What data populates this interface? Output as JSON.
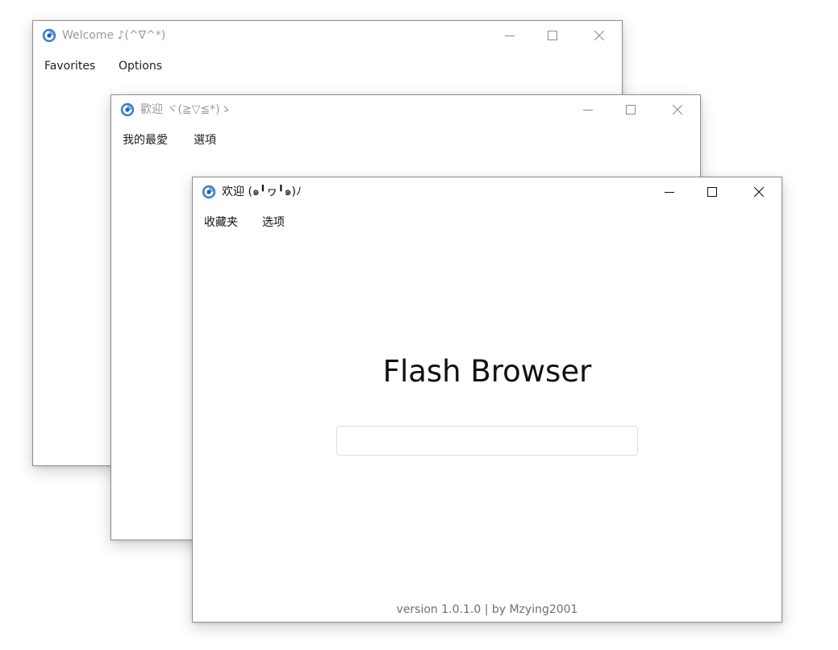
{
  "windows": {
    "back": {
      "title": "Welcome ♪(^∇^*)",
      "menu": [
        "Favorites",
        "Options"
      ]
    },
    "middle": {
      "title": "歡迎 ヾ(≧▽≦*)ゝ",
      "menu": [
        "我的最愛",
        "選項"
      ]
    },
    "front": {
      "title": "欢迎 (๑╹ヮ╹๑)ﾉ",
      "menu": [
        "收藏夹",
        "选项"
      ],
      "heading": "Flash Browser",
      "url_input": {
        "value": "",
        "placeholder": ""
      },
      "footer": "version 1.0.1.0 | by Mzying2001"
    }
  },
  "icons": {
    "app": "browser-logo-icon",
    "minimize": "minimize-icon",
    "maximize": "maximize-icon",
    "close": "close-icon"
  },
  "colors": {
    "inactive_title": "#9a9a9a",
    "active_title": "#111111",
    "footer_text": "#6f6f6f",
    "input_border": "#dcdcdc",
    "logo_blue": "#3b7fd1"
  }
}
